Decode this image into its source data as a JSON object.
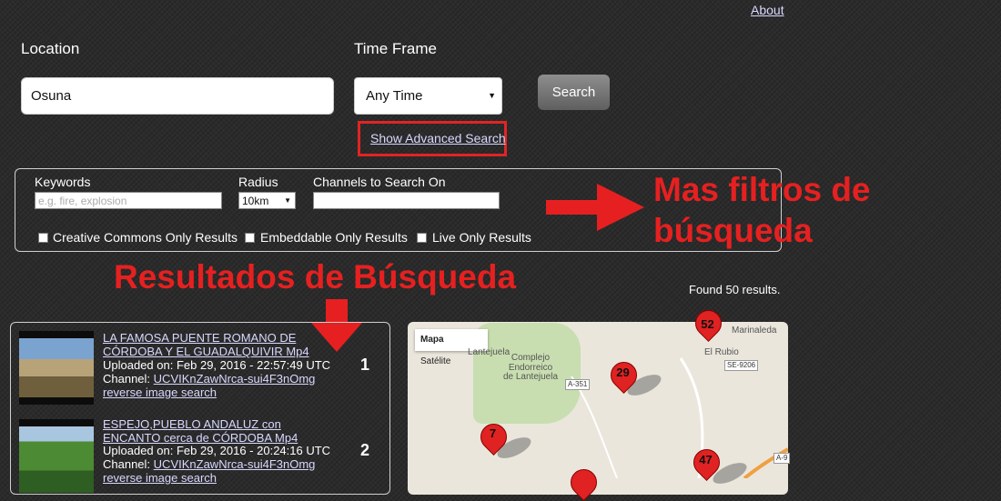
{
  "header": {
    "about_label": "About"
  },
  "search_form": {
    "location_label": "Location",
    "location_value": "Osuna",
    "time_frame_label": "Time Frame",
    "time_frame_value": "Any Time",
    "search_button": "Search",
    "advanced_link": "Show Advanced Search"
  },
  "advanced": {
    "keywords_label": "Keywords",
    "keywords_placeholder": "e.g. fire, explosion",
    "radius_label": "Radius",
    "radius_value": "10km",
    "channels_label": "Channels to Search On",
    "checkboxes": [
      "Creative Commons Only Results",
      "Embeddable Only Results",
      "Live Only Results"
    ]
  },
  "annotations": {
    "filters_line1": "Mas filtros de",
    "filters_line2": "búsqueda",
    "results_heading": "Resultados de Búsqueda"
  },
  "results_count": "Found 50 results.",
  "results": [
    {
      "title_line1": "LA FAMOSA PUENTE ROMANO DE",
      "title_line2": "CÓRDOBA Y EL GUADALQUIVIR Mp4",
      "uploaded": "Uploaded on: Feb 29, 2016 - 22:57:49 UTC",
      "channel_label": "Channel:",
      "channel": "UCVIKnZawNrca-sui4F3nOmg",
      "reverse": "reverse image search",
      "number": "1"
    },
    {
      "title_line1": "ESPEJO,PUEBLO ANDALUZ con",
      "title_line2": "ENCANTO cerca de CÓRDOBA Mp4",
      "uploaded": "Uploaded on: Feb 29, 2016 - 20:24:16 UTC",
      "channel_label": "Channel:",
      "channel": "UCVIKnZawNrca-sui4F3nOmg",
      "reverse": "reverse image search",
      "number": "2"
    }
  ],
  "map": {
    "type_buttons": [
      "Mapa",
      "Satélite"
    ],
    "places": [
      "Lantejuela",
      "Complejo",
      "Endorreico",
      "de Lantejuela",
      "Marinaleda",
      "El Rubio"
    ],
    "roads": [
      "A-351",
      "SE-9206",
      "A-9"
    ],
    "markers": [
      "29",
      "7",
      "47",
      "52"
    ],
    "accent_red": "#e02222"
  },
  "colors": {
    "annotation_red": "#e62020",
    "background": "#2b2b2b"
  }
}
